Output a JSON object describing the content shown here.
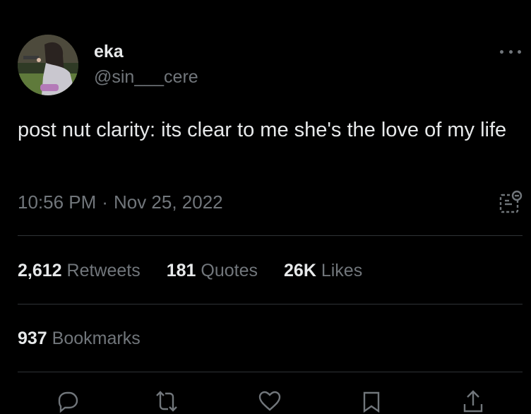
{
  "author": {
    "name": "eka",
    "handle": "@sin___cere",
    "avatar_icon": "profile-photo"
  },
  "tweet": {
    "text": "post nut clarity: its clear to me she's the love of my life"
  },
  "meta": {
    "time": "10:56 PM",
    "separator": "·",
    "date": "Nov 25, 2022"
  },
  "stats": {
    "retweets": {
      "count": "2,612",
      "label": "Retweets"
    },
    "quotes": {
      "count": "181",
      "label": "Quotes"
    },
    "likes": {
      "count": "26K",
      "label": "Likes"
    },
    "bookmarks": {
      "count": "937",
      "label": "Bookmarks"
    }
  },
  "actions": [
    "reply-icon",
    "retweet-icon",
    "like-icon",
    "bookmark-icon",
    "share-icon"
  ],
  "colors": {
    "background": "#000000",
    "primary_text": "#e7e9ea",
    "secondary_text": "#71767b",
    "divider": "#2f3336"
  }
}
